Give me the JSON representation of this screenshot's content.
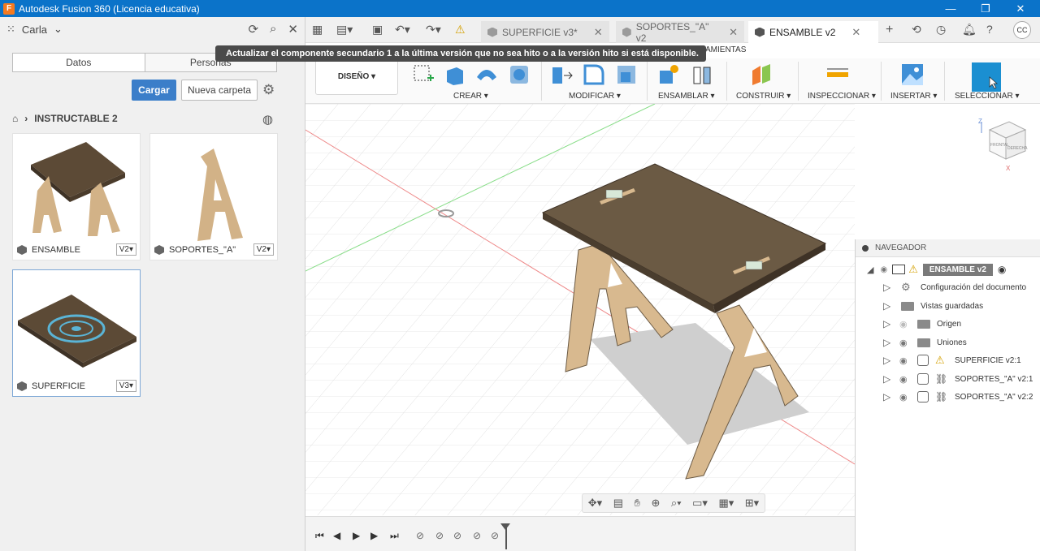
{
  "window": {
    "title": "Autodesk Fusion 360 (Licencia educativa)",
    "app_icon_letter": "F",
    "minimize": "—",
    "maximize": "❐",
    "close": "✕"
  },
  "data_panel": {
    "user": "Carla",
    "tabs": [
      "Datos",
      "Personas"
    ],
    "upload_label": "Cargar",
    "new_folder_label": "Nueva carpeta",
    "breadcrumb": "INSTRUCTABLE 2",
    "cards": [
      {
        "name": "ENSAMBLE",
        "version": "V2▾"
      },
      {
        "name": "SOPORTES_\"A\"",
        "version": "V2▾"
      },
      {
        "name": "SUPERFICIE",
        "version": "V3▾"
      }
    ]
  },
  "doc_tabs": [
    {
      "label": "SUPERFICIE v3*",
      "active": false
    },
    {
      "label": "SOPORTES_\"A\" v2",
      "active": false
    },
    {
      "label": "ENSAMBLE v2",
      "active": true
    }
  ],
  "avatar_initials": "CC",
  "tooltip": "Actualizar el componente secundario 1 a la última versión que no sea hito o a la versión hito si está disponible.",
  "ribbon_tab_hint": "AMIENTAS",
  "ribbon": {
    "workspace": "DISEÑO ▾",
    "groups": [
      "CREAR ▾",
      "MODIFICAR ▾",
      "ENSAMBLAR ▾",
      "CONSTRUIR ▾",
      "INSPECCIONAR ▾",
      "INSERTAR ▾",
      "SELECCIONAR ▾"
    ]
  },
  "browser": {
    "title": "NAVEGADOR",
    "root": "ENSAMBLE v2",
    "items": [
      {
        "label": "Configuración del documento",
        "icon": "gear-icon"
      },
      {
        "label": "Vistas guardadas",
        "icon": "folder-icon"
      },
      {
        "label": "Origen",
        "icon": "folder-icon"
      },
      {
        "label": "Uniones",
        "icon": "folder-icon"
      },
      {
        "label": "SUPERFICIE v2:1",
        "icon": "warning-icon"
      },
      {
        "label": "SOPORTES_\"A\" v2:1",
        "icon": "link-icon"
      },
      {
        "label": "SOPORTES_\"A\" v2:2",
        "icon": "link-icon"
      }
    ]
  },
  "viewcube": {
    "face_front": "FRONTAL",
    "face_right": "DERECHA",
    "axis_z": "Z",
    "axis_x": "X"
  },
  "colors": {
    "titlebar": "#0b73c9",
    "accent": "#3b7ec9",
    "wood": "#c9a679",
    "table_top": "#6b5a44"
  }
}
